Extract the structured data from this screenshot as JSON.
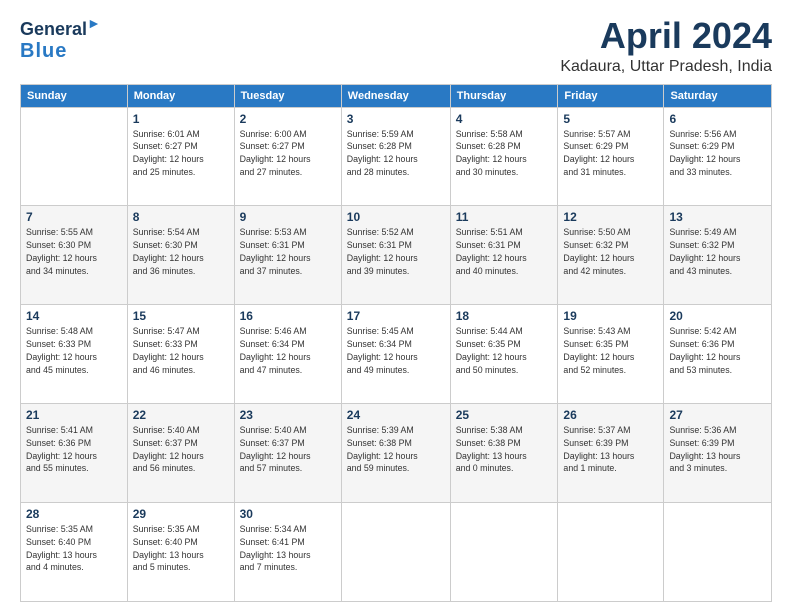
{
  "logo": {
    "line1": "General",
    "line2": "Blue"
  },
  "title": "April 2024",
  "subtitle": "Kadaura, Uttar Pradesh, India",
  "weekdays": [
    "Sunday",
    "Monday",
    "Tuesday",
    "Wednesday",
    "Thursday",
    "Friday",
    "Saturday"
  ],
  "weeks": [
    [
      {
        "day": "",
        "info": ""
      },
      {
        "day": "1",
        "info": "Sunrise: 6:01 AM\nSunset: 6:27 PM\nDaylight: 12 hours\nand 25 minutes."
      },
      {
        "day": "2",
        "info": "Sunrise: 6:00 AM\nSunset: 6:27 PM\nDaylight: 12 hours\nand 27 minutes."
      },
      {
        "day": "3",
        "info": "Sunrise: 5:59 AM\nSunset: 6:28 PM\nDaylight: 12 hours\nand 28 minutes."
      },
      {
        "day": "4",
        "info": "Sunrise: 5:58 AM\nSunset: 6:28 PM\nDaylight: 12 hours\nand 30 minutes."
      },
      {
        "day": "5",
        "info": "Sunrise: 5:57 AM\nSunset: 6:29 PM\nDaylight: 12 hours\nand 31 minutes."
      },
      {
        "day": "6",
        "info": "Sunrise: 5:56 AM\nSunset: 6:29 PM\nDaylight: 12 hours\nand 33 minutes."
      }
    ],
    [
      {
        "day": "7",
        "info": "Sunrise: 5:55 AM\nSunset: 6:30 PM\nDaylight: 12 hours\nand 34 minutes."
      },
      {
        "day": "8",
        "info": "Sunrise: 5:54 AM\nSunset: 6:30 PM\nDaylight: 12 hours\nand 36 minutes."
      },
      {
        "day": "9",
        "info": "Sunrise: 5:53 AM\nSunset: 6:31 PM\nDaylight: 12 hours\nand 37 minutes."
      },
      {
        "day": "10",
        "info": "Sunrise: 5:52 AM\nSunset: 6:31 PM\nDaylight: 12 hours\nand 39 minutes."
      },
      {
        "day": "11",
        "info": "Sunrise: 5:51 AM\nSunset: 6:31 PM\nDaylight: 12 hours\nand 40 minutes."
      },
      {
        "day": "12",
        "info": "Sunrise: 5:50 AM\nSunset: 6:32 PM\nDaylight: 12 hours\nand 42 minutes."
      },
      {
        "day": "13",
        "info": "Sunrise: 5:49 AM\nSunset: 6:32 PM\nDaylight: 12 hours\nand 43 minutes."
      }
    ],
    [
      {
        "day": "14",
        "info": "Sunrise: 5:48 AM\nSunset: 6:33 PM\nDaylight: 12 hours\nand 45 minutes."
      },
      {
        "day": "15",
        "info": "Sunrise: 5:47 AM\nSunset: 6:33 PM\nDaylight: 12 hours\nand 46 minutes."
      },
      {
        "day": "16",
        "info": "Sunrise: 5:46 AM\nSunset: 6:34 PM\nDaylight: 12 hours\nand 47 minutes."
      },
      {
        "day": "17",
        "info": "Sunrise: 5:45 AM\nSunset: 6:34 PM\nDaylight: 12 hours\nand 49 minutes."
      },
      {
        "day": "18",
        "info": "Sunrise: 5:44 AM\nSunset: 6:35 PM\nDaylight: 12 hours\nand 50 minutes."
      },
      {
        "day": "19",
        "info": "Sunrise: 5:43 AM\nSunset: 6:35 PM\nDaylight: 12 hours\nand 52 minutes."
      },
      {
        "day": "20",
        "info": "Sunrise: 5:42 AM\nSunset: 6:36 PM\nDaylight: 12 hours\nand 53 minutes."
      }
    ],
    [
      {
        "day": "21",
        "info": "Sunrise: 5:41 AM\nSunset: 6:36 PM\nDaylight: 12 hours\nand 55 minutes."
      },
      {
        "day": "22",
        "info": "Sunrise: 5:40 AM\nSunset: 6:37 PM\nDaylight: 12 hours\nand 56 minutes."
      },
      {
        "day": "23",
        "info": "Sunrise: 5:40 AM\nSunset: 6:37 PM\nDaylight: 12 hours\nand 57 minutes."
      },
      {
        "day": "24",
        "info": "Sunrise: 5:39 AM\nSunset: 6:38 PM\nDaylight: 12 hours\nand 59 minutes."
      },
      {
        "day": "25",
        "info": "Sunrise: 5:38 AM\nSunset: 6:38 PM\nDaylight: 13 hours\nand 0 minutes."
      },
      {
        "day": "26",
        "info": "Sunrise: 5:37 AM\nSunset: 6:39 PM\nDaylight: 13 hours\nand 1 minute."
      },
      {
        "day": "27",
        "info": "Sunrise: 5:36 AM\nSunset: 6:39 PM\nDaylight: 13 hours\nand 3 minutes."
      }
    ],
    [
      {
        "day": "28",
        "info": "Sunrise: 5:35 AM\nSunset: 6:40 PM\nDaylight: 13 hours\nand 4 minutes."
      },
      {
        "day": "29",
        "info": "Sunrise: 5:35 AM\nSunset: 6:40 PM\nDaylight: 13 hours\nand 5 minutes."
      },
      {
        "day": "30",
        "info": "Sunrise: 5:34 AM\nSunset: 6:41 PM\nDaylight: 13 hours\nand 7 minutes."
      },
      {
        "day": "",
        "info": ""
      },
      {
        "day": "",
        "info": ""
      },
      {
        "day": "",
        "info": ""
      },
      {
        "day": "",
        "info": ""
      }
    ]
  ]
}
